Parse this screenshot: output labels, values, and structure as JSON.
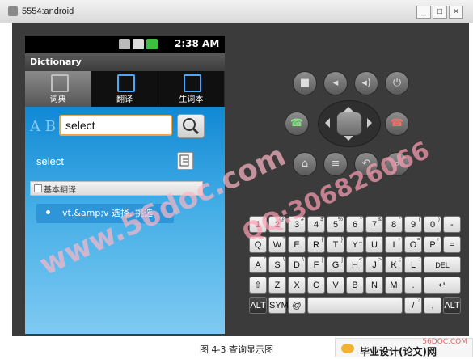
{
  "window": {
    "title": "5554:android",
    "buttons": [
      "_",
      "□",
      "×"
    ]
  },
  "phone": {
    "status_time": "2:38 AM",
    "app_title": "Dictionary",
    "tabs": [
      {
        "label": "词典",
        "icon": "dictionary-icon",
        "active": true
      },
      {
        "label": "翻译",
        "icon": "translate-icon",
        "active": false
      },
      {
        "label": "生词本",
        "icon": "notebook-icon",
        "active": false
      }
    ],
    "search_value": "select",
    "result_word": "select",
    "section_title": "基本翻译",
    "definition": "vt.&amp;v 选择, 挑选"
  },
  "emulator": {
    "top_buttons": [
      {
        "icon": "camera-icon"
      },
      {
        "icon": "volume-down-icon"
      },
      {
        "icon": "volume-up-icon"
      },
      {
        "icon": "power-icon"
      }
    ],
    "nav_buttons": [
      {
        "icon": "call-icon"
      },
      {
        "icon": "end-call-icon"
      },
      {
        "icon": "home-icon"
      },
      {
        "icon": "menu-icon"
      },
      {
        "icon": "back-icon"
      },
      {
        "icon": "search-icon"
      }
    ],
    "keyboard_rows": [
      [
        {
          "k": "1",
          "s": "!"
        },
        {
          "k": "2",
          "s": "@"
        },
        {
          "k": "3",
          "s": "#"
        },
        {
          "k": "4",
          "s": "$"
        },
        {
          "k": "5",
          "s": "%"
        },
        {
          "k": "6",
          "s": "^"
        },
        {
          "k": "7",
          "s": "&"
        },
        {
          "k": "8",
          "s": "*"
        },
        {
          "k": "9",
          "s": "("
        },
        {
          "k": "0",
          "s": ")"
        }
      ],
      [
        {
          "k": "Q",
          "s": "~"
        },
        {
          "k": "W",
          "s": "\""
        },
        {
          "k": "E",
          "s": "`"
        },
        {
          "k": "R",
          "s": "{"
        },
        {
          "k": "T",
          "s": "}"
        },
        {
          "k": "Y",
          "s": "_"
        },
        {
          "k": "U",
          "s": "-"
        },
        {
          "k": "I",
          "s": "+"
        },
        {
          "k": "O",
          "s": "="
        },
        {
          "k": "P",
          "s": "+"
        }
      ],
      [
        {
          "k": "A",
          "s": "'"
        },
        {
          "k": "S",
          "s": "\\"
        },
        {
          "k": "D",
          "s": "\\"
        },
        {
          "k": "F",
          "s": "["
        },
        {
          "k": "G",
          "s": "]"
        },
        {
          "k": "H",
          "s": "<"
        },
        {
          "k": "J",
          "s": ">"
        },
        {
          "k": "K",
          "s": ";"
        },
        {
          "k": "L",
          "s": ":"
        }
      ],
      [
        {
          "k": "⇧",
          "s": ""
        },
        {
          "k": "Z",
          "s": ""
        },
        {
          "k": "X",
          "s": ""
        },
        {
          "k": "C",
          "s": ""
        },
        {
          "k": "V",
          "s": ""
        },
        {
          "k": "B",
          "s": ""
        },
        {
          "k": "N",
          "s": ""
        },
        {
          "k": "M",
          "s": ""
        },
        {
          "k": ".",
          "s": ""
        },
        {
          "k": "↵",
          "s": ""
        }
      ],
      [
        {
          "k": "ALT",
          "s": ""
        },
        {
          "k": "SYM",
          "s": ""
        },
        {
          "k": "@",
          "s": ""
        },
        {
          "k": "",
          "s": ""
        },
        {
          "k": "/",
          "s": "?"
        },
        {
          "k": ",",
          "s": ""
        },
        {
          "k": "ALT",
          "s": ""
        }
      ]
    ],
    "right_keys": [
      "-",
      "=",
      "DEL"
    ]
  },
  "watermark": {
    "site": "www.56doc.com",
    "qq": "QQ:306826066",
    "corner_site": "56DOC.COM",
    "corner_name": "毕业设计(论文)网"
  },
  "caption": "图 4-3 查询显示图"
}
